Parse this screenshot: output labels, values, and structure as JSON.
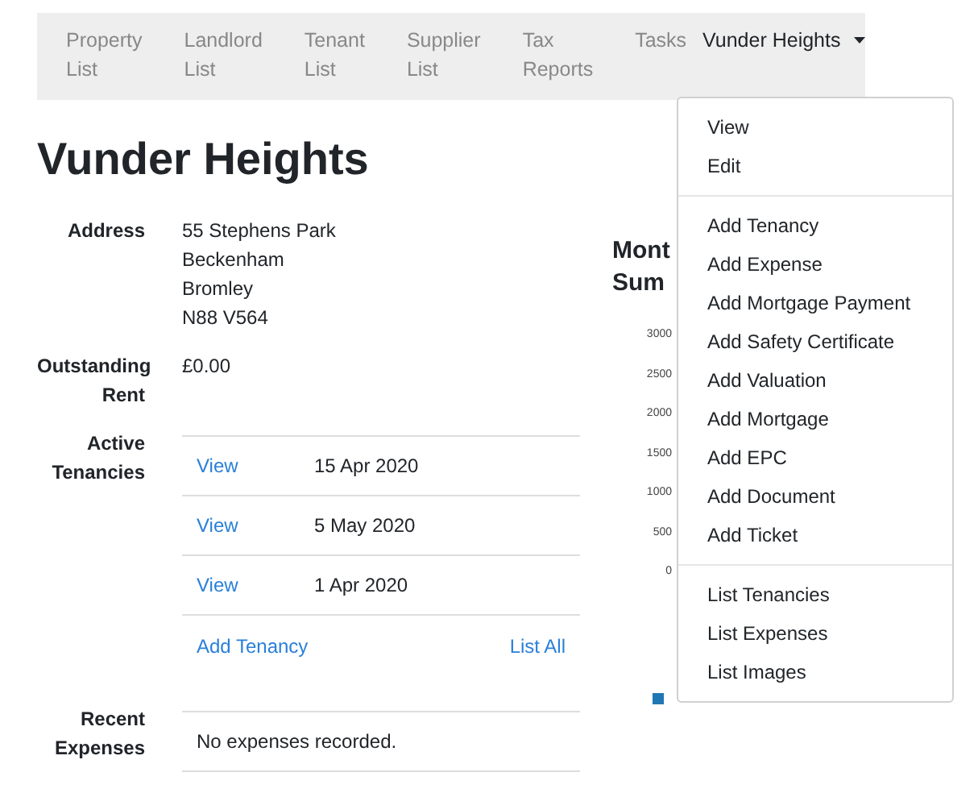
{
  "navbar": {
    "items": [
      {
        "label": "Property List",
        "selected": false,
        "kind": "link"
      },
      {
        "label": "Landlord List",
        "selected": false,
        "kind": "link"
      },
      {
        "label": "Tenant List",
        "selected": false,
        "kind": "link"
      },
      {
        "label": "Supplier List",
        "selected": false,
        "kind": "link"
      },
      {
        "label": "Tax Reports",
        "selected": false,
        "kind": "link"
      },
      {
        "label": "Tasks",
        "selected": false,
        "kind": "link"
      },
      {
        "label": "Vunder Heights",
        "selected": true,
        "kind": "dropdown",
        "expanded": true
      }
    ]
  },
  "dropdown_menu": {
    "groups": [
      [
        "View",
        "Edit"
      ],
      [
        "Add Tenancy",
        "Add Expense",
        "Add Mortgage Payment",
        "Add Safety Certificate",
        "Add Valuation",
        "Add Mortgage",
        "Add EPC",
        "Add Document",
        "Add Ticket"
      ],
      [
        "List Tenancies",
        "List Expenses",
        "List Images"
      ]
    ]
  },
  "title": "Vunder Heights",
  "details": {
    "address": {
      "label": "Address",
      "lines": [
        "55 Stephens Park",
        "Beckenham",
        "Bromley",
        "N88 V564"
      ]
    },
    "outstanding_rent": {
      "label": "Outstanding Rent",
      "value": "£0.00"
    },
    "active_tenancies": {
      "label": "Active Tenancies",
      "rows": [
        {
          "link": "View",
          "date": "15 Apr 2020"
        },
        {
          "link": "View",
          "date": "5 May 2020"
        },
        {
          "link": "View",
          "date": "1 Apr 2020"
        }
      ],
      "add_link": "Add Tenancy",
      "list_link": "List All"
    },
    "recent_expenses": {
      "label": "Recent Expenses",
      "empty_text": "No expenses recorded."
    }
  },
  "chart_panel": {
    "title_lines": [
      "Mont",
      "Sum"
    ],
    "y_tick_labels": [
      "3000",
      "2500",
      "2000",
      "1500",
      "1000",
      "500",
      "0"
    ]
  }
}
